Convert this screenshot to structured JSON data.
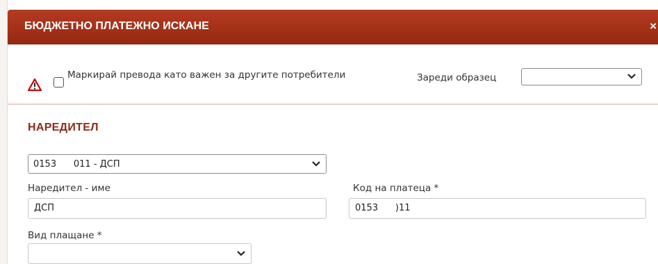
{
  "dialog": {
    "title": "БЮДЖЕТНО ПЛАТЕЖНО ИСКАНЕ",
    "close_glyph": "×"
  },
  "options": {
    "mark_important_label": "Маркирай превода като важен за другите потребители",
    "mark_important_checked": false,
    "load_template_label": "Зареди образец",
    "load_template_value": ""
  },
  "orderer": {
    "section_title": "НАРЕДИТЕЛ",
    "account_select_value": "0153      011 - ДСП",
    "name_label": "Наредител - име",
    "name_value": "ДСП",
    "payer_code_label": "Код на платеца *",
    "payer_code_value": "0153      )11",
    "payment_type_label": "Вид плащане *",
    "payment_type_value": ""
  },
  "colors": {
    "header": "#a2321a",
    "section_title": "#8b2a1a",
    "warning_icon": "#cc0000"
  }
}
